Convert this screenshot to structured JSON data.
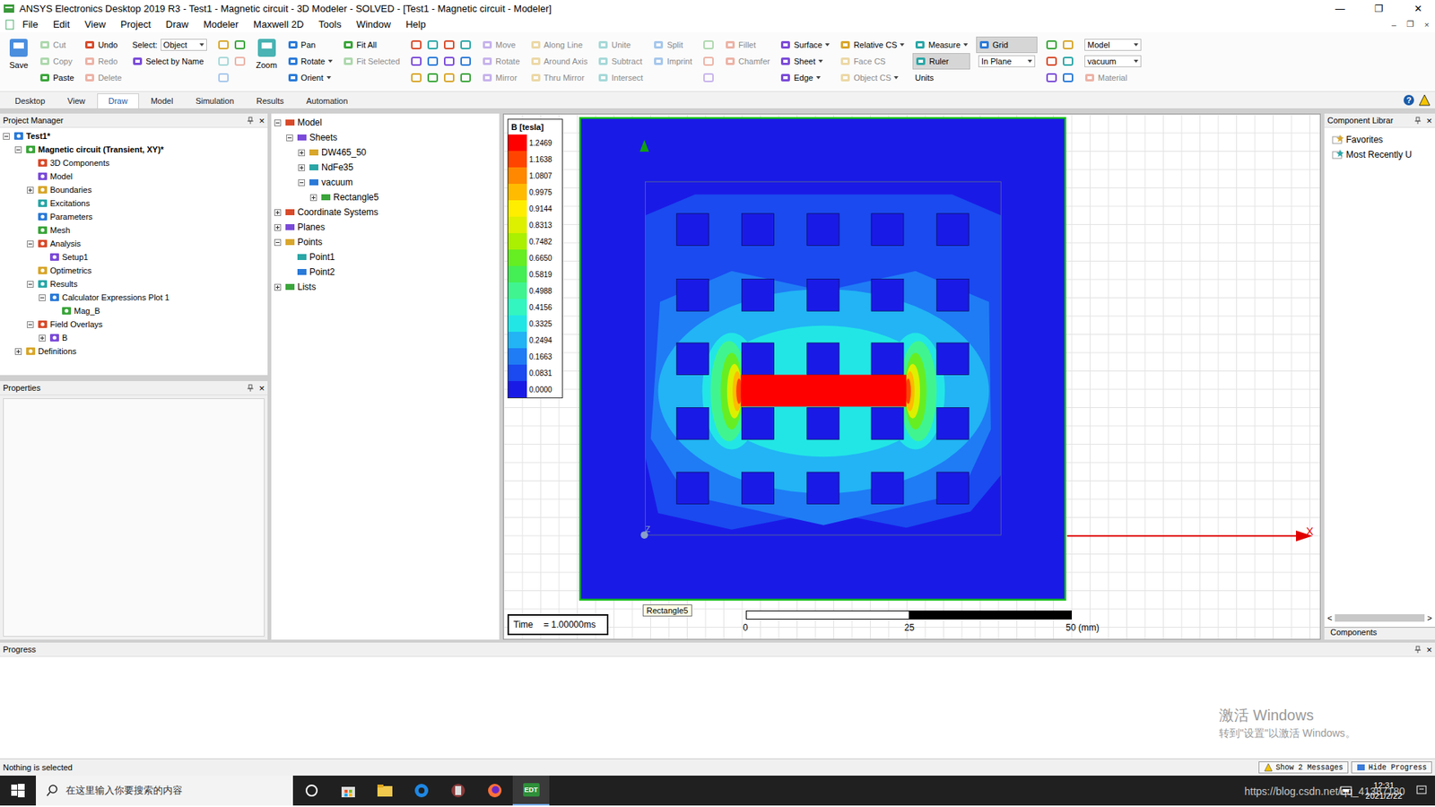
{
  "window": {
    "title": "ANSYS Electronics Desktop 2019 R3 - Test1 - Magnetic circuit - 3D Modeler - SOLVED - [Test1 - Magnetic circuit - Modeler]",
    "app_badge": "EDT",
    "controls": [
      "—",
      "❐",
      "✕"
    ],
    "mdi_controls": [
      "–",
      "❐",
      "×"
    ]
  },
  "menu": [
    "File",
    "Edit",
    "View",
    "Project",
    "Draw",
    "Modeler",
    "Maxwell 2D",
    "Tools",
    "Window",
    "Help"
  ],
  "toolbar": [
    {
      "kind": "big",
      "items": [
        {
          "label": "Save",
          "disabled": false
        }
      ]
    },
    {
      "kind": "stack",
      "items": [
        {
          "label": "Cut",
          "disabled": true
        },
        {
          "label": "Copy",
          "disabled": true
        },
        {
          "label": "Paste",
          "disabled": false
        }
      ]
    },
    {
      "kind": "stack",
      "items": [
        {
          "label": "Undo",
          "disabled": false
        },
        {
          "label": "Redo",
          "disabled": true
        },
        {
          "label": "Delete",
          "disabled": true
        }
      ]
    },
    {
      "kind": "select",
      "label": "Select:",
      "value": "Object",
      "items": [
        {
          "label": "Select by Name",
          "disabled": false
        }
      ]
    },
    {
      "kind": "icons",
      "items": [
        {
          "disabled": false
        },
        {
          "disabled": true
        },
        {
          "disabled": true
        },
        {
          "disabled": false
        },
        {
          "disabled": true
        }
      ]
    },
    {
      "kind": "big",
      "items": [
        {
          "label": "Zoom",
          "disabled": false
        }
      ]
    },
    {
      "kind": "stack",
      "items": [
        {
          "label": "Pan",
          "disabled": false
        },
        {
          "label": "Rotate",
          "disabled": false,
          "menu": true
        },
        {
          "label": "Orient",
          "disabled": false,
          "menu": true
        }
      ]
    },
    {
      "kind": "stack",
      "items": [
        {
          "label": "Fit All",
          "disabled": false
        },
        {
          "label": "Fit Selected",
          "disabled": true
        }
      ]
    },
    {
      "kind": "icons",
      "items": [
        {
          "disabled": false
        },
        {
          "disabled": false
        },
        {
          "disabled": false
        },
        {
          "disabled": false
        },
        {
          "disabled": false
        },
        {
          "disabled": false
        },
        {
          "disabled": false
        },
        {
          "disabled": false
        },
        {
          "disabled": false
        },
        {
          "disabled": false
        },
        {
          "disabled": false
        },
        {
          "disabled": false
        }
      ]
    },
    {
      "kind": "stack",
      "items": [
        {
          "label": "Move",
          "disabled": true
        },
        {
          "label": "Rotate",
          "disabled": true
        },
        {
          "label": "Mirror",
          "disabled": true
        }
      ]
    },
    {
      "kind": "stack",
      "items": [
        {
          "label": "Along Line",
          "disabled": true
        },
        {
          "label": "Around Axis",
          "disabled": true
        },
        {
          "label": "Thru Mirror",
          "disabled": true
        }
      ]
    },
    {
      "kind": "stack",
      "items": [
        {
          "label": "Unite",
          "disabled": true
        },
        {
          "label": "Subtract",
          "disabled": true
        },
        {
          "label": "Intersect",
          "disabled": true
        }
      ]
    },
    {
      "kind": "stack",
      "items": [
        {
          "label": "Split",
          "disabled": true
        },
        {
          "label": "Imprint",
          "disabled": true
        }
      ]
    },
    {
      "kind": "icons",
      "items": [
        {
          "disabled": true
        },
        {
          "disabled": true
        },
        {
          "disabled": true
        }
      ]
    },
    {
      "kind": "stack",
      "items": [
        {
          "label": "Fillet",
          "disabled": true
        },
        {
          "label": "Chamfer",
          "disabled": true
        }
      ]
    },
    {
      "kind": "stack",
      "items": [
        {
          "label": "Surface",
          "disabled": false,
          "menu": true
        },
        {
          "label": "Sheet",
          "disabled": false,
          "menu": true
        },
        {
          "label": "Edge",
          "disabled": false,
          "menu": true
        }
      ]
    },
    {
      "kind": "stack",
      "items": [
        {
          "label": "Relative CS",
          "disabled": false,
          "menu": true
        },
        {
          "label": "Face CS",
          "disabled": true
        },
        {
          "label": "Object CS",
          "disabled": true,
          "menu": true
        }
      ]
    },
    {
      "kind": "stack",
      "items": [
        {
          "label": "Measure",
          "disabled": false,
          "menu": true,
          "pressed": false
        },
        {
          "label": "Ruler",
          "disabled": false,
          "pressed": true
        },
        {
          "label": "Units",
          "disabled": false,
          "pressed": false,
          "noicon": true
        }
      ]
    },
    {
      "kind": "stack",
      "items": [
        {
          "label": "Grid",
          "disabled": false,
          "pressed": true,
          "box": false
        },
        {
          "label": "In Plane",
          "disabled": false,
          "pressed": false,
          "box": true
        }
      ]
    },
    {
      "kind": "icons",
      "items": [
        {
          "disabled": false
        },
        {
          "disabled": false
        },
        {
          "disabled": false
        },
        {
          "disabled": false
        },
        {
          "disabled": false
        },
        {
          "disabled": false
        }
      ]
    },
    {
      "kind": "stack",
      "items": [
        {
          "label": "Model",
          "disabled": false,
          "box": true
        },
        {
          "label": "vacuum",
          "disabled": false,
          "box": true
        },
        {
          "label": "Material",
          "disabled": true,
          "box": false
        }
      ]
    }
  ],
  "ribbon_tabs": [
    {
      "label": "Desktop",
      "selected": false
    },
    {
      "label": "View",
      "selected": false
    },
    {
      "label": "Draw",
      "selected": true
    },
    {
      "label": "Model",
      "selected": false
    },
    {
      "label": "Simulation",
      "selected": false
    },
    {
      "label": "Results",
      "selected": false
    },
    {
      "label": "Automation",
      "selected": false
    }
  ],
  "help": "?",
  "project_manager": {
    "title": "Project Manager",
    "close": "×",
    "items": [
      {
        "label": "Test1*",
        "depth": 0,
        "expandable": true,
        "expanded": true,
        "bold": true
      },
      {
        "label": "Magnetic circuit (Transient, XY)*",
        "depth": 1,
        "expandable": true,
        "expanded": true,
        "bold": true
      },
      {
        "label": "3D Components",
        "depth": 2,
        "expandable": false,
        "expanded": false,
        "bold": false
      },
      {
        "label": "Model",
        "depth": 2,
        "expandable": false,
        "expanded": false,
        "bold": false
      },
      {
        "label": "Boundaries",
        "depth": 2,
        "expandable": true,
        "expanded": false,
        "bold": false
      },
      {
        "label": "Excitations",
        "depth": 2,
        "expandable": false,
        "expanded": false,
        "bold": false
      },
      {
        "label": "Parameters",
        "depth": 2,
        "expandable": false,
        "expanded": false,
        "bold": false
      },
      {
        "label": "Mesh",
        "depth": 2,
        "expandable": false,
        "expanded": false,
        "bold": false
      },
      {
        "label": "Analysis",
        "depth": 2,
        "expandable": true,
        "expanded": true,
        "bold": false
      },
      {
        "label": "Setup1",
        "depth": 3,
        "expandable": false,
        "expanded": false,
        "bold": false
      },
      {
        "label": "Optimetrics",
        "depth": 2,
        "expandable": false,
        "expanded": false,
        "bold": false
      },
      {
        "label": "Results",
        "depth": 2,
        "expandable": true,
        "expanded": true,
        "bold": false
      },
      {
        "label": "Calculator Expressions Plot 1",
        "depth": 3,
        "expandable": true,
        "expanded": true,
        "bold": false
      },
      {
        "label": "Mag_B",
        "depth": 4,
        "expandable": false,
        "expanded": false,
        "bold": false
      },
      {
        "label": "Field Overlays",
        "depth": 2,
        "expandable": true,
        "expanded": true,
        "bold": false
      },
      {
        "label": "B",
        "depth": 3,
        "expandable": true,
        "expanded": false,
        "bold": false
      },
      {
        "label": "Definitions",
        "depth": 1,
        "expandable": true,
        "expanded": false,
        "bold": false
      }
    ]
  },
  "properties": {
    "title": "Properties",
    "close": "×"
  },
  "model_tree": [
    {
      "label": "Model",
      "depth": 0,
      "expandable": true,
      "expanded": true
    },
    {
      "label": "Sheets",
      "depth": 1,
      "expandable": true,
      "expanded": true
    },
    {
      "label": "DW465_50",
      "depth": 2,
      "expandable": true,
      "expanded": false
    },
    {
      "label": "NdFe35",
      "depth": 2,
      "expandable": true,
      "expanded": false
    },
    {
      "label": "vacuum",
      "depth": 2,
      "expandable": true,
      "expanded": true
    },
    {
      "label": "Rectangle5",
      "depth": 3,
      "expandable": true,
      "expanded": false
    },
    {
      "label": "Coordinate Systems",
      "depth": 0,
      "expandable": true,
      "expanded": false
    },
    {
      "label": "Planes",
      "depth": 0,
      "expandable": true,
      "expanded": false
    },
    {
      "label": "Points",
      "depth": 0,
      "expandable": true,
      "expanded": true
    },
    {
      "label": "Point1",
      "depth": 1,
      "expandable": false,
      "expanded": false
    },
    {
      "label": "Point2",
      "depth": 1,
      "expandable": false,
      "expanded": false
    },
    {
      "label": "Lists",
      "depth": 0,
      "expandable": true,
      "expanded": false
    }
  ],
  "legend": {
    "title": "B [tesla]",
    "entries": [
      {
        "value": "1.2469",
        "color": "#ff0000"
      },
      {
        "value": "1.1638",
        "color": "#ff4400"
      },
      {
        "value": "1.0807",
        "color": "#ff8800"
      },
      {
        "value": "0.9975",
        "color": "#ffbb00"
      },
      {
        "value": "0.9144",
        "color": "#ffee00"
      },
      {
        "value": "0.8313",
        "color": "#ddf000"
      },
      {
        "value": "0.7482",
        "color": "#aaf000"
      },
      {
        "value": "0.6650",
        "color": "#66ee22"
      },
      {
        "value": "0.5819",
        "color": "#44ee55"
      },
      {
        "value": "0.4988",
        "color": "#40f590"
      },
      {
        "value": "0.4156",
        "color": "#33f5c0"
      },
      {
        "value": "0.3325",
        "color": "#22e6e6"
      },
      {
        "value": "0.2494",
        "color": "#22b4f5"
      },
      {
        "value": "0.1663",
        "color": "#1f7cf5"
      },
      {
        "value": "0.0831",
        "color": "#1a4af0"
      },
      {
        "value": "0.0000",
        "color": "#1a1ae6"
      }
    ]
  },
  "time": {
    "label": "Time",
    "value": "= 1.00000ms"
  },
  "tooltip": "Rectangle5",
  "scale": {
    "ticks": [
      "0",
      "25",
      "50 (mm)"
    ]
  },
  "axes": {
    "x": "X",
    "z": "Z"
  },
  "component_library": {
    "title": "Component Librar",
    "close": "×",
    "items": [
      "Favorites",
      "Most Recently U"
    ],
    "scroll_left": "<",
    "scroll_right": ">",
    "tab": "Components"
  },
  "progress": {
    "title": "Progress",
    "close": "×"
  },
  "status_bar": {
    "text": "Nothing is selected",
    "buttons": [
      "Show 2 Messages",
      "Hide Progress"
    ]
  },
  "taskbar": {
    "search_placeholder": "在这里输入你要搜索的内容",
    "time": "12:31",
    "date": "2021/2/22"
  },
  "watermarks": {
    "activate_title": "激活 Windows",
    "activate_hint": "转到\"设置\"以激活 Windows。",
    "url": "https://blog.csdn.net/qq_41387180"
  }
}
